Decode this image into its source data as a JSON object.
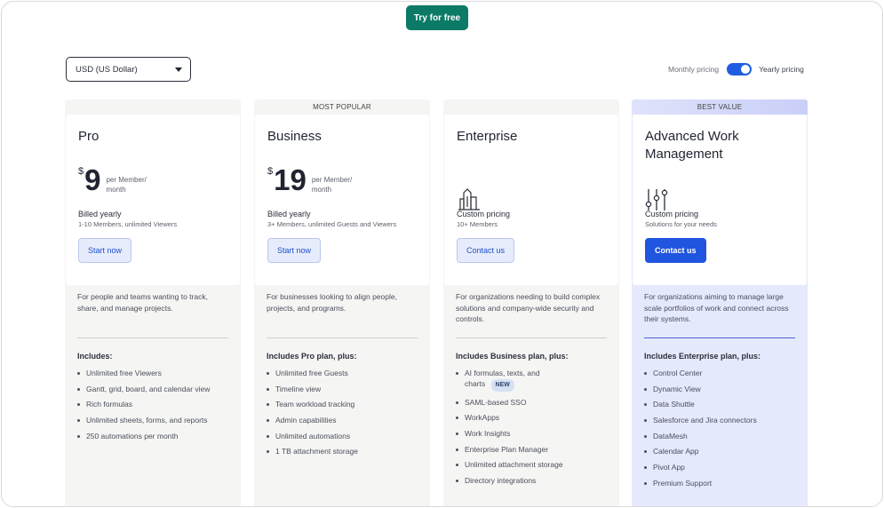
{
  "header": {
    "try_label": "Try for free"
  },
  "currency": {
    "selected": "USD (US Dollar)"
  },
  "billing": {
    "monthly_label": "Monthly pricing",
    "yearly_label": "Yearly pricing",
    "yearly_selected": true
  },
  "plans": [
    {
      "banner": "",
      "title": "Pro",
      "price_currency": "$",
      "price": "9",
      "price_per": "per Member/ month",
      "billing_title": "Billed yearly",
      "billing_sub": "1-10 Members, unlimited Viewers",
      "cta": "Start now",
      "description": "For people and teams wanting to track, share, and manage projects.",
      "includes": "Includes:",
      "features": [
        "Unlimited free Viewers",
        "Gantt, grid, board, and calendar view",
        "Rich formulas",
        "Unlimited sheets, forms, and reports",
        "250 automations per month"
      ]
    },
    {
      "banner": "MOST POPULAR",
      "title": "Business",
      "price_currency": "$",
      "price": "19",
      "price_per": "per Member/ month",
      "billing_title": "Billed yearly",
      "billing_sub": "3+ Members, unlimited Guests and Viewers",
      "cta": "Start now",
      "description": "For businesses looking to align people, projects, and programs.",
      "includes": "Includes Pro plan, plus:",
      "features": [
        "Unlimited free Guests",
        "Timeline view",
        "Team workload tracking",
        "Admin capabilities",
        "Unlimited automations",
        "1 TB attachment storage"
      ]
    },
    {
      "banner": "",
      "title": "Enterprise",
      "icon": "buildings-icon",
      "billing_title": "Custom pricing",
      "billing_sub": "10+ Members",
      "cta": "Contact us",
      "description": "For organizations needing to build complex solutions and company-wide security and controls.",
      "includes": "Includes Business plan, plus:",
      "features": [
        "AI formulas, texts, and charts",
        "SAML-based SSO",
        "WorkApps",
        "Work Insights",
        "Enterprise Plan Manager",
        "Unlimited attachment storage",
        "Directory integrations"
      ],
      "feature_badge": "NEW"
    },
    {
      "banner": "BEST VALUE",
      "title": "Advanced Work Management",
      "icon": "sliders-icon",
      "billing_title": "Custom pricing",
      "billing_sub": "Solutions for your needs",
      "cta": "Contact us",
      "description": "For organizations aiming to manage large scale portfolios of work and connect across their systems.",
      "includes": "Includes Enterprise plan, plus:",
      "features": [
        "Control Center",
        "Dynamic View",
        "Data Shuttle",
        "Salesforce and Jira connectors",
        "DataMesh",
        "Calendar App",
        "Pivot App",
        "Premium Support"
      ]
    }
  ]
}
